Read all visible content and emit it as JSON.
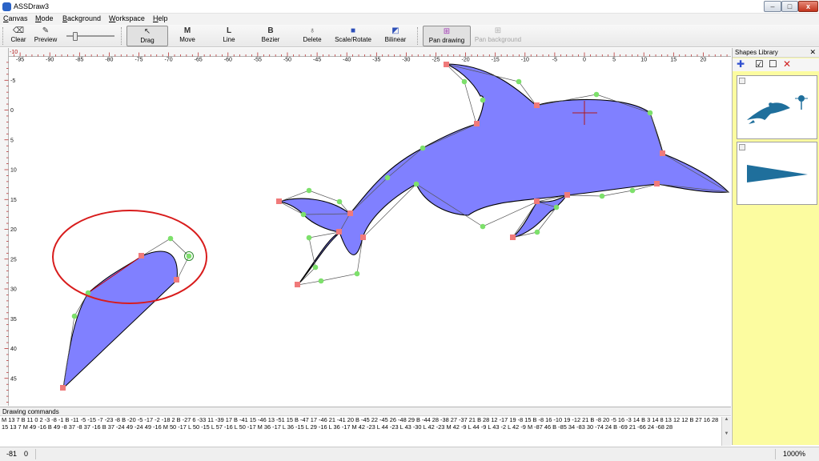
{
  "app": {
    "title": "ASSDraw3"
  },
  "window_controls": {
    "minimize": "–",
    "maximize": "□",
    "close": "x"
  },
  "menu": [
    "Canvas",
    "Mode",
    "Background",
    "Workspace",
    "Help"
  ],
  "toolbar": {
    "clear": "Clear",
    "preview": "Preview",
    "drag": "Drag",
    "move": "Move",
    "line": "Line",
    "bezier": "Bezier",
    "delete": "Delete",
    "scale_rotate": "Scale/Rotate",
    "bilinear": "Bilinear",
    "pan_drawing": "Pan drawing",
    "pan_background": "Pan background",
    "icons": {
      "move": "M",
      "line": "L",
      "bezier": "B"
    }
  },
  "ruler": {
    "x_labels": [
      "-95",
      "-90",
      "-85",
      "-80",
      "-75",
      "-70",
      "-65",
      "-60",
      "-55",
      "-50",
      "-45",
      "-40",
      "-35",
      "-30",
      "-25",
      "-20",
      "-15",
      "-10",
      "-5",
      "0",
      "5",
      "10",
      "15",
      "20"
    ],
    "y_labels": [
      "-5",
      "0",
      "5",
      "10",
      "15",
      "20",
      "25",
      "30",
      "35",
      "40",
      "45"
    ],
    "corner_label": "-10"
  },
  "shapes_library": {
    "title": "Shapes Library",
    "close": "✕"
  },
  "commands": {
    "title": "Drawing commands",
    "text": "M 13 7 B 11 0 2 -3 -8 -1 B -11 -5 -15 -7 -23 -8 B -20 -5 -17 -2 -18 2 B -27 6 -33 11 -39 17 B -41 15 -46 13 -51 15 B -47 17 -46 21 -41 20 B -45 22 -45 26 -48 29 B -44 28 -38 27 -37 21 B 28 12 -17 19 -8 15 B -8 16 -10 19 -12 21 B -8 20 -5 16 -3 14 B 3 14 8 13 12 12 B 27 16 28 15 13 7 M 49 -16 B 49 -8 37 -8 37 -16 B 37 -24 49 -24 49 -16 M 50 -17 L 50 -15 L 57 -16 L 50 -17 M 36 -17 L 36 -15 L 29 -16 L 36 -17 M 42 -23 L 44 -23 L 43 -30 L 42 -23 M 42 -9 L 44 -9 L 43 -2 L 42 -9 M -87 46 B -85 34 -83 30 -74 24 B -69 21 -66 24 -68 28"
  },
  "status": {
    "x": "-81",
    "y": "0",
    "zoom": "1000%"
  },
  "colors": {
    "fill": "#8080ff",
    "origin_marker": "#b01818",
    "node": "#f07a7a",
    "control": "#7de06b",
    "highlight": "#d81c1c",
    "thumb_shape": "#1f6f9c",
    "library_bg": "#fcfca0"
  }
}
